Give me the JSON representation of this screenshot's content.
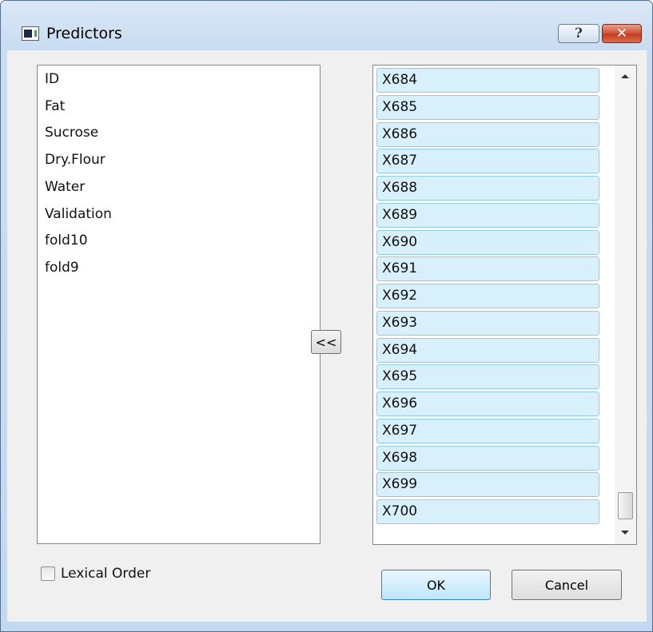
{
  "window": {
    "title": "Predictors"
  },
  "titlebar": {
    "help_label": "?",
    "close_label": "✕"
  },
  "available_list": {
    "items": [
      "ID",
      "Fat",
      "Sucrose",
      "Dry.Flour",
      "Water",
      "Validation",
      "fold10",
      "fold9"
    ]
  },
  "move_button": {
    "label": "<<"
  },
  "selected_list": {
    "items": [
      "X684",
      "X685",
      "X686",
      "X687",
      "X688",
      "X689",
      "X690",
      "X691",
      "X692",
      "X693",
      "X694",
      "X695",
      "X696",
      "X697",
      "X698",
      "X699",
      "X700"
    ]
  },
  "lexical_order": {
    "label": "Lexical Order",
    "checked": false
  },
  "buttons": {
    "ok": "OK",
    "cancel": "Cancel"
  }
}
